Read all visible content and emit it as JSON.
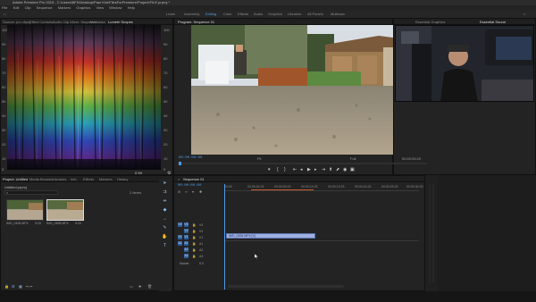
{
  "window": {
    "title": "Adobe Premiere Pro 2019 - C:\\Users\\BFK\\Desktop\\Paul Kim\\FilesForPremiere\\Project\\FILE.prproj *"
  },
  "menu": [
    "File",
    "Edit",
    "Clip",
    "Sequence",
    "Markers",
    "Graphics",
    "View",
    "Window",
    "Help"
  ],
  "workspaces": {
    "items": [
      "Learn",
      "Assembly",
      "Editing",
      "Color",
      "Effects",
      "Audio",
      "Graphics",
      "Libraries",
      "All Panels",
      "Multicam"
    ],
    "active": "Editing"
  },
  "source_panel": {
    "tabs": [
      "Source: (no clips)",
      "Effect Controls",
      "Audio Clip Mixer: Sequence",
      "Metadata",
      "Lumetri Scopes"
    ],
    "active_tab": "Lumetri Scopes",
    "scale_left": [
      "100",
      "90",
      "80",
      "70",
      "60",
      "50",
      "40",
      "30",
      "20",
      "10",
      "0"
    ],
    "scale_right": [
      "100",
      "90",
      "80",
      "70",
      "60",
      "50",
      "40",
      "30",
      "20",
      "10",
      "0"
    ],
    "footer": "8 Bit"
  },
  "program_monitor": {
    "tabs": [
      "Program: Sequence 01"
    ],
    "timecode_current": "00:00:00:00",
    "timecode_duration": "00:00:05:20",
    "fit": "Fit",
    "quality": "Full"
  },
  "webcam_panel": {
    "tabs": [
      "Essential Graphics",
      "Essential Sound"
    ]
  },
  "project_panel": {
    "tabs": [
      "Project: Untitled",
      "Media Browser",
      "Libraries",
      "Info",
      "Effects",
      "Markers",
      "History"
    ],
    "project_name": "Untitled.prproj",
    "search_placeholder": "",
    "items_count": "2 Items",
    "clips": [
      {
        "name": "IMG_0455.MP4",
        "duration": "5:20"
      },
      {
        "name": "IMG_0455.MP4",
        "duration": "5:20"
      }
    ]
  },
  "timeline": {
    "tab": "Sequence 01",
    "timecode": "00:00:00:00",
    "ruler": [
      "00:00",
      "00:00:04:23",
      "00:00:09:23",
      "00:00:14:23",
      "00:00:19:23",
      "00:00:24:23",
      "00:00:29:23",
      "00:00:34:23"
    ],
    "tracks": [
      {
        "id": "V3",
        "label": "V3"
      },
      {
        "id": "V2",
        "label": "V2"
      },
      {
        "id": "V1",
        "label": "V1"
      },
      {
        "id": "A1",
        "label": "A1"
      },
      {
        "id": "A2",
        "label": "A2"
      },
      {
        "id": "A3",
        "label": "A3"
      }
    ],
    "master": "Master",
    "master_value": "0.0",
    "clip_label": "IMG_0455.MP4 [V]"
  },
  "colors": {
    "accent": "#4f9be8",
    "panel": "#232323",
    "clip": "#9db0df"
  }
}
